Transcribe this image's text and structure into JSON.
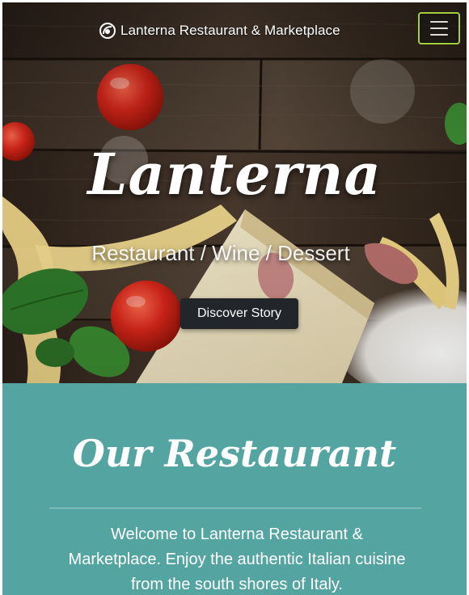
{
  "navbar": {
    "brand_icon": "lantern-logo-icon",
    "brand_text": "Lanterna Restaurant & Marketplace",
    "toggler_icon": "hamburger-menu-icon",
    "toggler_border_color": "#a6cf3e"
  },
  "hero": {
    "title": "Lanterna",
    "subtitle": "Restaurant / Wine / Dessert",
    "cta_label": "Discover Story",
    "background": "pasta-tomatoes-parmesan-on-dark-wood-photo"
  },
  "restaurant": {
    "title": "Our Restaurant",
    "intro": "Welcome to Lanterna Restaurant & Marketplace. Enjoy the authentic Italian cuisine from the south shores of Italy.",
    "background_color": "#54a4a2"
  }
}
